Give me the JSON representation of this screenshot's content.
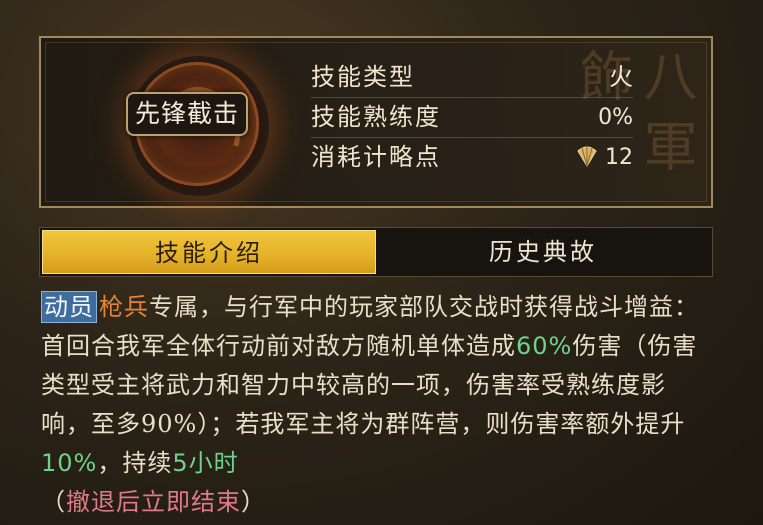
{
  "skill": {
    "name": "先锋截击",
    "stats": [
      {
        "label": "技能类型",
        "value": "火"
      },
      {
        "label": "技能熟练度",
        "value": "0%"
      },
      {
        "label": "消耗计略点",
        "value": "12",
        "icon": "fan-icon"
      }
    ]
  },
  "tabs": [
    {
      "label": "技能介绍",
      "active": true
    },
    {
      "label": "历史典故",
      "active": false
    }
  ],
  "description": {
    "badge": "动员",
    "unit": "枪兵",
    "text1": "专属，与行军中的玩家部队交战时获得战斗增益：首回合我军全体行动前对敌方随机单体造成",
    "dmg": "60%",
    "text2": "伤害（伤害类型受主将武力和智力中较高的一项，伤害率受熟练度影响，至多90%）；若我军主将为群阵营，则伤害率额外提升",
    "bonus": "10%",
    "text3": "，持续",
    "duration": "5小时",
    "text4_open": "（",
    "retreat": "撤退后立即结束",
    "text4_close": "）"
  },
  "colors": {
    "accent_gold": "#e6b32a",
    "unit_orange": "#e2833b",
    "number_green": "#6fd28a",
    "retreat_pink": "#e07a8a",
    "badge_blue": "#3f6c9e"
  }
}
